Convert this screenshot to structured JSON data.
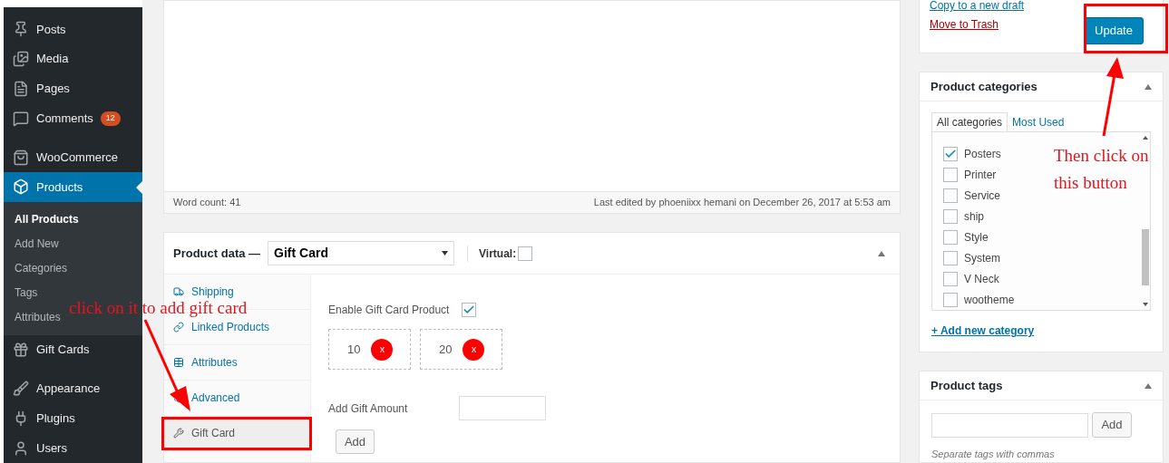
{
  "sidebar": {
    "items": [
      {
        "label": "Posts",
        "selected": false
      },
      {
        "label": "Media",
        "selected": false
      },
      {
        "label": "Pages",
        "selected": false
      },
      {
        "label": "Comments",
        "selected": false,
        "badge": "12"
      },
      {
        "label": "WooCommerce",
        "selected": false
      },
      {
        "label": "Products",
        "selected": true,
        "children": [
          {
            "label": "All Products",
            "selected": true
          },
          {
            "label": "Add New",
            "selected": false
          },
          {
            "label": "Categories",
            "selected": false
          },
          {
            "label": "Tags",
            "selected": false
          },
          {
            "label": "Attributes",
            "selected": false
          }
        ]
      },
      {
        "label": "Gift Cards",
        "selected": false
      },
      {
        "label": "Appearance",
        "selected": false
      },
      {
        "label": "Plugins",
        "selected": false
      },
      {
        "label": "Users",
        "selected": false
      }
    ]
  },
  "editor": {
    "word_count": "Word count: 41",
    "last_edited": "Last edited by phoeniixx hemani on December 26, 2017 at 5:53 am"
  },
  "product_data": {
    "title": "Product data —",
    "type_select": "Gift Card",
    "virtual_label": "Virtual:",
    "virtual": false,
    "tabs": [
      {
        "label": "Shipping",
        "selected": false
      },
      {
        "label": "Linked Products",
        "selected": false
      },
      {
        "label": "Attributes",
        "selected": false
      },
      {
        "label": "Advanced",
        "selected": false
      },
      {
        "label": "Gift Card",
        "selected": true
      }
    ],
    "enable_label": "Enable Gift Card Product",
    "enable": true,
    "amounts": [
      {
        "value": "10",
        "remove": "x"
      },
      {
        "value": "20",
        "remove": "x"
      }
    ],
    "add_amount_label": "Add Gift Amount",
    "add_button": "Add"
  },
  "publish": {
    "copy_link": "Copy to a new draft",
    "trash_link": "Move to Trash",
    "update_button": "Update"
  },
  "categories": {
    "title": "Product categories",
    "tabs": [
      {
        "label": "All categories",
        "selected": true
      },
      {
        "label": "Most Used",
        "selected": false
      }
    ],
    "items": [
      {
        "label": "Posters",
        "checked": true
      },
      {
        "label": "Printer",
        "checked": false
      },
      {
        "label": "Service",
        "checked": false
      },
      {
        "label": "ship",
        "checked": false
      },
      {
        "label": "Style",
        "checked": false
      },
      {
        "label": "System",
        "checked": false
      },
      {
        "label": "V Neck",
        "checked": false
      },
      {
        "label": "wootheme",
        "checked": false
      }
    ],
    "add_link": "+ Add new category"
  },
  "tags": {
    "title": "Product tags",
    "add_button": "Add",
    "hint": "Separate tags with commas"
  },
  "annotations": [
    {
      "text": "click on it to add gift card"
    },
    {
      "text": "Then click on"
    },
    {
      "text": "this button"
    }
  ]
}
